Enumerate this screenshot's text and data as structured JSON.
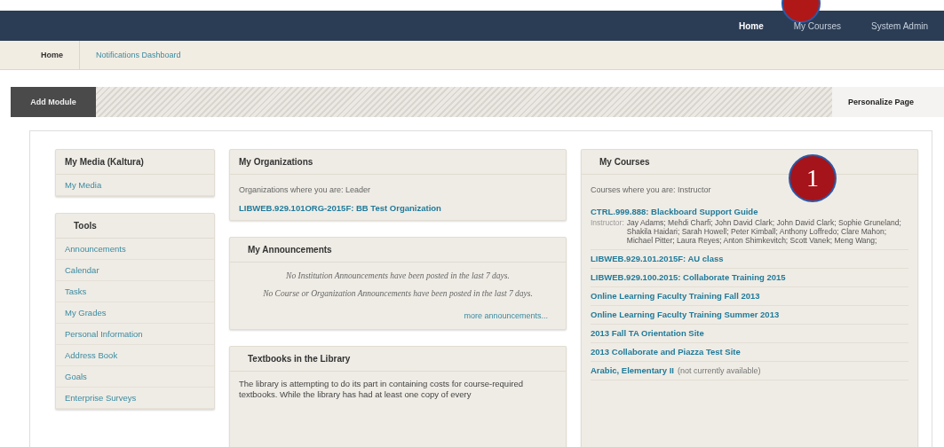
{
  "nav_tabs": [
    {
      "label": "Home",
      "selected": true
    },
    {
      "label": "My Courses",
      "selected": false
    },
    {
      "label": "System Admin",
      "selected": false
    }
  ],
  "breadcrumb": [
    "Home",
    "Notifications Dashboard"
  ],
  "toolbar": {
    "add_button": "Add Module",
    "personalize_button": "Personalize Page"
  },
  "media_module": {
    "title": "My Media (Kaltura)",
    "links": [
      "My Media"
    ]
  },
  "tools_module": {
    "title": "Tools",
    "links": [
      "Announcements",
      "Calendar",
      "Tasks",
      "My Grades",
      "Personal Information",
      "Address Book",
      "Goals",
      "Enterprise Surveys"
    ]
  },
  "organizations_module": {
    "title": "My Organizations",
    "intro": "Organizations where you are: Leader",
    "links": [
      "LIBWEB.929.101ORG-2015F: BB Test Organization"
    ]
  },
  "announcements_module": {
    "title": "My Announcements",
    "messages": [
      "No Institution Announcements have been posted in the last 7 days.",
      "No Course or Organization Announcements have been posted in the last 7 days."
    ],
    "more_link": "more announcements..."
  },
  "textbooks_module": {
    "title": "Textbooks in the Library",
    "text": "The library is attempting to do its part in containing costs for course-required textbooks.  While the library has had at least one copy of every"
  },
  "courses_module": {
    "title": "My Courses",
    "intro": "Courses where you are: Instructor",
    "courses": [
      {
        "title": "CTRL.999.888: Blackboard Support Guide",
        "instructor_label": "Instructor:",
        "instructors": "Jay Adams;  Mehdi Charfi;  John David Clark;  John David Clark;  Sophie Gruneland;  Shakila Haidari;  Sarah Howell;  Peter Kimball;  Anthony Loffredo;  Clare Mahon;  Michael Pitter;  Laura Reyes;  Anton Shimkevitch;  Scott Vanek;  Meng Wang;"
      },
      {
        "title": "LIBWEB.929.101.2015F: AU class"
      },
      {
        "title": "LIBWEB.929.100.2015: Collaborate Training 2015"
      },
      {
        "title": "Online Learning Faculty Training Fall 2013"
      },
      {
        "title": "Online Learning Faculty Training Summer 2013"
      },
      {
        "title": "2013 Fall TA Orientation Site"
      },
      {
        "title": "2013 Collaborate and Piazza Test Site"
      },
      {
        "title": "Arabic, Elementary II",
        "note": "(not currently available)"
      }
    ]
  },
  "annotation": {
    "number": "1"
  }
}
